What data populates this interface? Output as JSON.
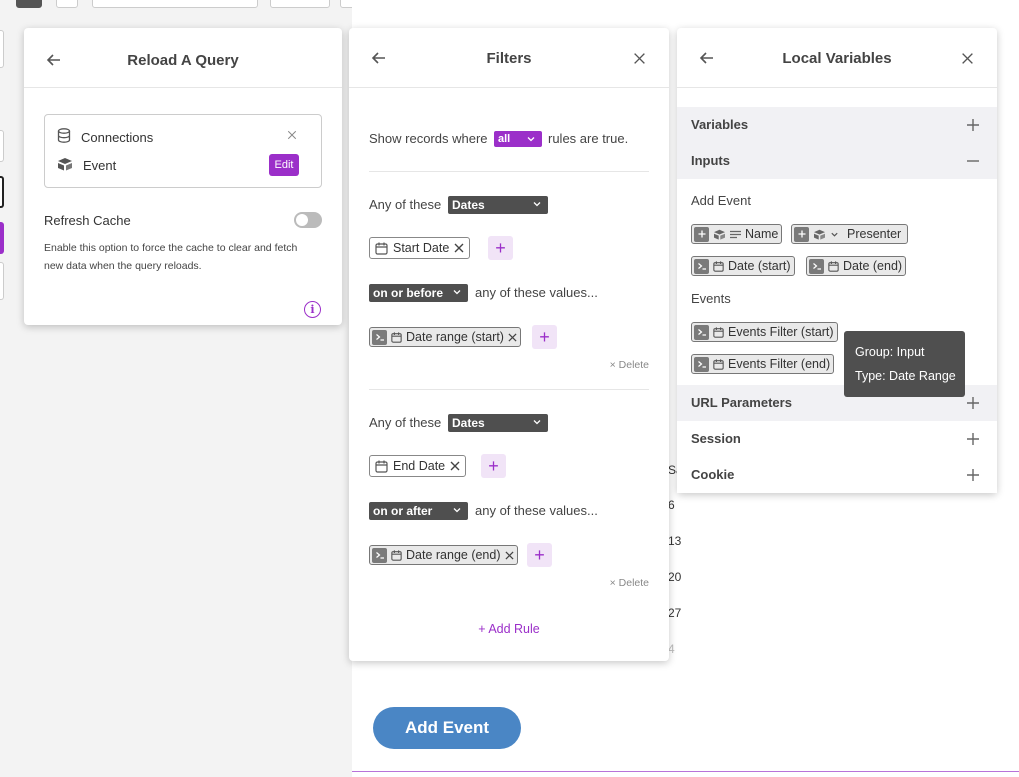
{
  "reload_panel": {
    "title": "Reload A Query",
    "connections_label": "Connections",
    "event_label": "Event",
    "edit_label": "Edit",
    "refresh_cache_label": "Refresh Cache",
    "refresh_cache_on": false,
    "refresh_cache_desc": "Enable this option to force the cache to clear and fetch new data when the query reloads.",
    "info_glyph": "i"
  },
  "filters_panel": {
    "title": "Filters",
    "show_prefix": "Show records where",
    "match_mode": "all",
    "show_suffix": "rules are true.",
    "rules": [
      {
        "any_of_these": "Any of these",
        "field_group": "Dates",
        "field_chip": "Start Date",
        "operator": "on or before",
        "values_text": "any of these values...",
        "value_chip": "Date range (start)",
        "delete_label": "Delete"
      },
      {
        "any_of_these": "Any of these",
        "field_group": "Dates",
        "field_chip": "End Date",
        "operator": "on or after",
        "values_text": "any of these values...",
        "value_chip": "Date range (end)",
        "delete_label": "Delete"
      }
    ],
    "add_rule_label": "+ Add Rule"
  },
  "local_vars_panel": {
    "title": "Local Variables",
    "sections": {
      "variables": "Variables",
      "inputs": "Inputs",
      "url_parameters": "URL Parameters",
      "session": "Session",
      "cookie": "Cookie"
    },
    "add_event_label": "Add Event",
    "add_event_chips": [
      "Name",
      "Presenter",
      "Date (start)",
      "Date (end)"
    ],
    "events_label": "Events",
    "events_chips": [
      "Events Filter (start)",
      "Events Filter (end)"
    ],
    "tooltip": {
      "group": "Group: Input",
      "type": "Type: Date Range"
    }
  },
  "canvas": {
    "add_event_button": "Add Event",
    "calendar_numbers": [
      "Sa",
      "6",
      "13",
      "20",
      "27",
      "4"
    ]
  },
  "colors": {
    "accent_purple": "#9b2fc9",
    "button_blue": "#4a86c5",
    "dark_pill": "#4f4f4f"
  }
}
